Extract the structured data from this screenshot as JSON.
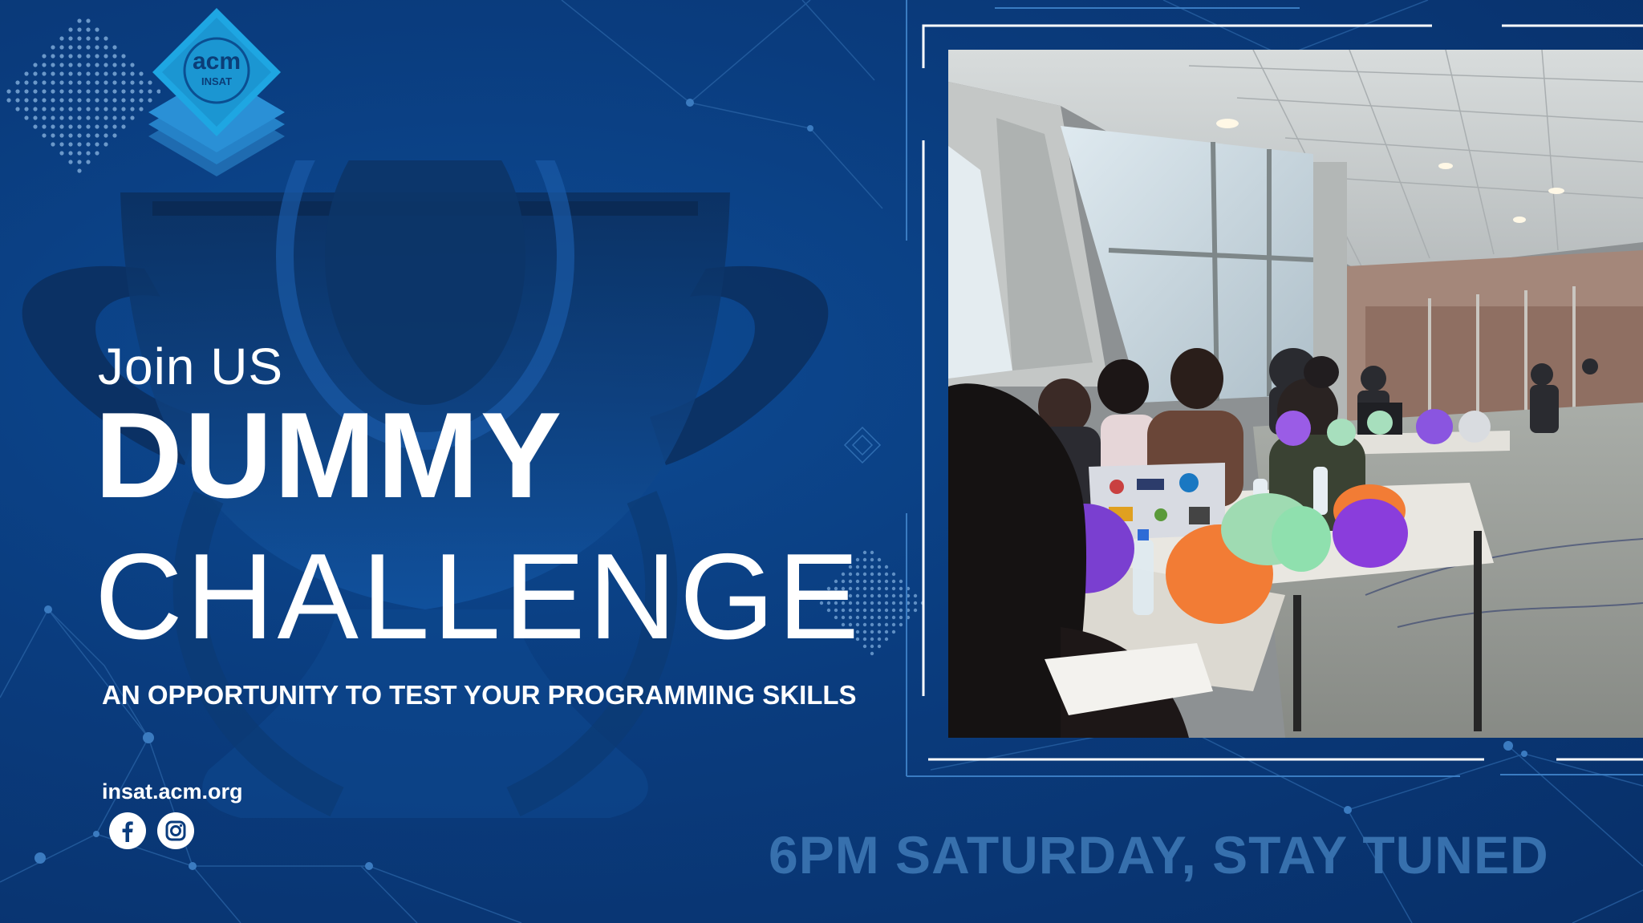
{
  "brand": {
    "logo_text_main": "acm",
    "logo_text_sub": "INSAT",
    "primary_color": "#0a3c7e",
    "accent_color": "#1aa6e0",
    "muted_text_color": "#3770ad"
  },
  "headline": {
    "intro": "Join US",
    "title_line1": "DUMMY",
    "title_line2": "CHALLENGE",
    "tagline": "AN OPPORTUNITY TO TEST YOUR PROGRAMMING SKILLS"
  },
  "footer": {
    "website": "insat.acm.org",
    "social_icons": [
      "facebook-icon",
      "instagram-icon"
    ],
    "schedule": "6PM SATURDAY, STAY TUNED"
  },
  "photo": {
    "subject": "hall-with-contestants"
  }
}
